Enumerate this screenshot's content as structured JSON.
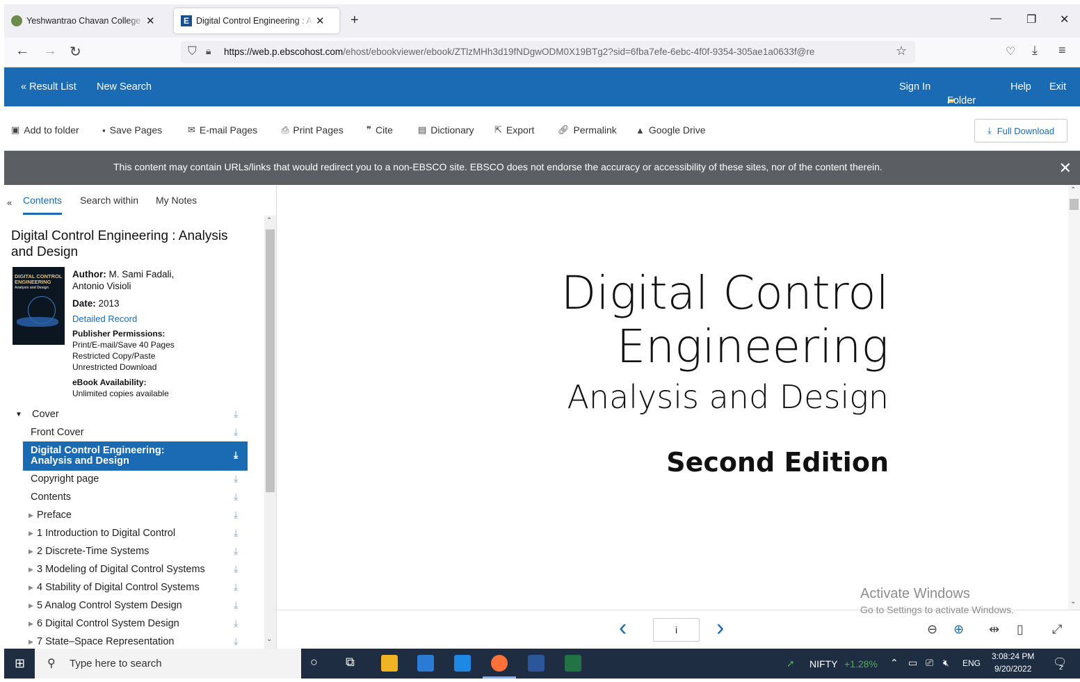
{
  "browser": {
    "tabs": [
      {
        "title": "Yeshwantrao Chavan College of"
      },
      {
        "title": "Digital Control Engineering : An"
      }
    ],
    "new_tab": "+",
    "url_host": "https://web.p.ebscohost.com",
    "url_path": "/ehost/ebookviewer/ebook/ZTlzMHh3d19fNDgwODM0X19BTg2?sid=6fba7efe-6ebc-4f0f-9354-305ae1a0633f@re",
    "window_controls": {
      "minimize": "—",
      "restore": "❐",
      "close": "✕"
    }
  },
  "ebsco_header": {
    "result_list": "« Result List",
    "new_search": "New Search",
    "sign_in": "Sign In",
    "folder": "Folder",
    "help": "Help",
    "exit": "Exit"
  },
  "toolbar": {
    "add_to_folder": "Add to folder",
    "save_pages": "Save Pages",
    "email_pages": "E-mail Pages",
    "print_pages": "Print Pages",
    "cite": "Cite",
    "dictionary": "Dictionary",
    "export": "Export",
    "permalink": "Permalink",
    "google_drive": "Google Drive",
    "full_download": "Full Download"
  },
  "notice": {
    "text": "This content may contain URLs/links that would redirect you to a non-EBSCO site. EBSCO does not endorse the accuracy or accessibility of these sites, nor of the content therein.",
    "close": "✕"
  },
  "sidebar": {
    "collapse": "«",
    "tabs": [
      "Contents",
      "Search within",
      "My Notes"
    ],
    "book_title": "Digital Control Engineering : Analysis and Design",
    "author_label": "Author:",
    "author_line1": "M. Sami Fadali,",
    "author_line2": "Antonio Visioli",
    "date_label": "Date:",
    "date_value": "2013",
    "detailed_record": "Detailed Record",
    "permissions_label": "Publisher Permissions:",
    "permissions": [
      "Print/E-mail/Save 40 Pages",
      "Restricted Copy/Paste",
      "Unrestricted Download"
    ],
    "availability_label": "eBook Availability:",
    "availability_value": "Unlimited copies available",
    "cover_text": [
      "DIGITAL CONTROL",
      "ENGINEERING",
      "Analysis and Design"
    ],
    "toc": [
      {
        "label": "Cover",
        "expander": "▼"
      },
      {
        "label": "Front Cover"
      },
      {
        "label_line1": "Digital Control Engineering:",
        "label_line2": "Analysis and Design"
      },
      {
        "label": "Copyright page"
      },
      {
        "label": "Contents"
      },
      {
        "label": "Preface"
      },
      {
        "label": "1 Introduction to Digital Control"
      },
      {
        "label": "2 Discrete-Time Systems"
      },
      {
        "label": "3 Modeling of Digital Control Systems"
      },
      {
        "label": "4 Stability of Digital Control Systems"
      },
      {
        "label": "5 Analog Control System Design"
      },
      {
        "label": "6 Digital Control System Design"
      },
      {
        "label": "7 State–Space Representation"
      }
    ]
  },
  "page": {
    "line1": "Digital Control",
    "line2": "Engineering",
    "line3": "Analysis and Design",
    "edition": "Second Edition"
  },
  "pager": {
    "prev": "‹",
    "next": "›",
    "page_value": "i"
  },
  "watermark": {
    "line1": "Activate Windows",
    "line2": "Go to Settings to activate Windows."
  },
  "taskbar": {
    "search_placeholder": "Type here to search",
    "nifty_label": "NIFTY",
    "nifty_change": "+1.28%",
    "lang": "ENG",
    "time": "3:08:24 PM",
    "date": "9/20/2022",
    "notification_count": "2"
  }
}
